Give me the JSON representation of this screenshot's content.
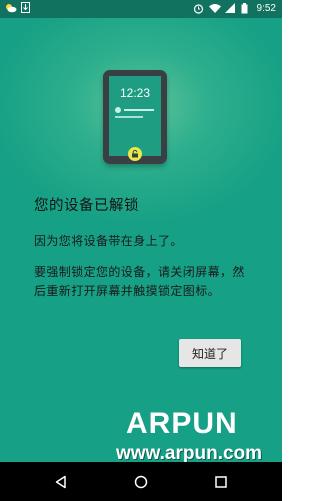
{
  "status_bar": {
    "time": "9:52",
    "icons_left": [
      "weather-icon",
      "download-icon"
    ],
    "icons_right": [
      "alarm-icon",
      "wifi-icon",
      "signal-icon",
      "battery-icon"
    ]
  },
  "illustration": {
    "phone_time": "12:23"
  },
  "dialog": {
    "title": "您的设备已解锁",
    "message_1": "因为您将设备带在身上了。",
    "message_2": "要强制锁定您的设备，请关闭屏幕，然后重新打开屏幕并触摸锁定图标。",
    "ok_label": "知道了"
  },
  "watermark": {
    "brand": "ARPUN",
    "url": "www.arpun.com"
  },
  "nav_bar": {
    "buttons": [
      "back",
      "home",
      "recents"
    ]
  },
  "colors": {
    "background": "#16a085",
    "status_bar": "#10725f",
    "button": "#e6e6e6",
    "badge": "#e7e94a"
  }
}
